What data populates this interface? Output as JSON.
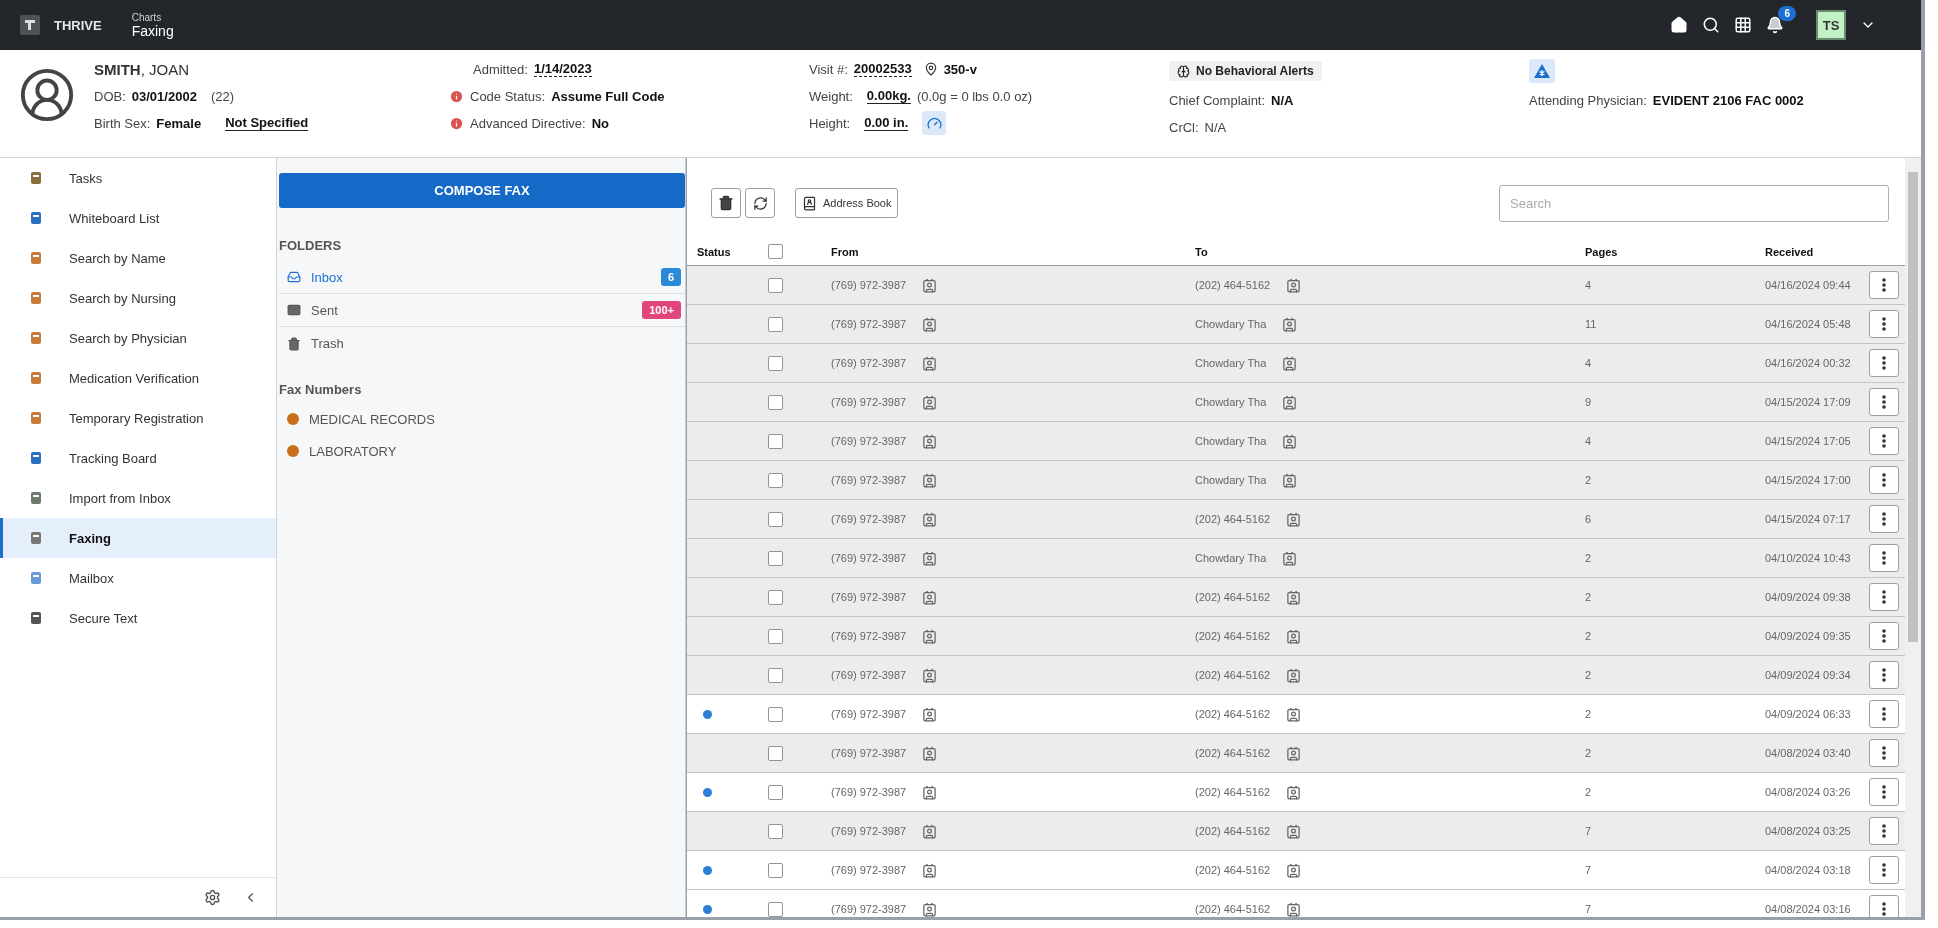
{
  "app": {
    "brand": "THRIVE",
    "breadcrumb": "Charts",
    "title": "Faxing",
    "notifications": "6",
    "user_initials": "TS"
  },
  "patient": {
    "name": "**SMITH**, JOAN",
    "dob_label": "DOB:",
    "dob": "03/01/2002",
    "age": "(22)",
    "sex_label": "Birth Sex:",
    "sex": "Female",
    "gender": "Not Specified",
    "admitted_label": "Admitted:",
    "admitted": "1/14/2023",
    "code_status_label": "Code Status:",
    "code_status": "Assume Full Code",
    "directive_label": "Advanced Directive:",
    "directive": "No",
    "visit_label": "Visit #:",
    "visit": "20002533",
    "room": "350-v",
    "weight_label": "Weight:",
    "weight": "0.00kg.",
    "weight_note": "(0.0g = 0 lbs 0.0 oz)",
    "height_label": "Height:",
    "height": "0.00 in.",
    "behavioral": "No Behavioral Alerts",
    "complaint_label": "Chief Complaint:",
    "complaint": "N/A",
    "crcl_label": "CrCl:",
    "crcl": "N/A",
    "physician_label": "Attending Physician:",
    "physician": "EVIDENT 2106 FAC 0002"
  },
  "sidebar": {
    "items": [
      {
        "label": "Tasks",
        "selected": false
      },
      {
        "label": "Whiteboard List",
        "selected": false
      },
      {
        "label": "Search by Name",
        "selected": false
      },
      {
        "label": "Search by Nursing",
        "selected": false
      },
      {
        "label": "Search by Physician",
        "selected": false
      },
      {
        "label": "Medication Verification",
        "selected": false
      },
      {
        "label": "Temporary Registration",
        "selected": false
      },
      {
        "label": "Tracking Board",
        "selected": false
      },
      {
        "label": "Import from Inbox",
        "selected": false
      },
      {
        "label": "Faxing",
        "selected": true
      },
      {
        "label": "Mailbox",
        "selected": false
      },
      {
        "label": "Secure Text",
        "selected": false
      }
    ]
  },
  "folders_panel": {
    "compose": "COMPOSE FAX",
    "folders_title": "FOLDERS",
    "folders": [
      {
        "label": "Inbox",
        "selected": true,
        "count": "6",
        "color": "#2b8ad8"
      },
      {
        "label": "Sent",
        "selected": false,
        "count": "100+",
        "color": "#e0457b"
      },
      {
        "label": "Trash",
        "selected": false
      }
    ],
    "fax_numbers_title": "Fax Numbers",
    "fax_numbers": [
      {
        "label": "MEDICAL RECORDS",
        "color": "#c8701e"
      },
      {
        "label": "LABORATORY",
        "color": "#c8701e"
      }
    ]
  },
  "toolbar": {
    "address_book": "Address Book",
    "search_placeholder": "Search"
  },
  "table": {
    "columns": [
      "Status",
      "From",
      "To",
      "Pages",
      "Received"
    ],
    "all_checked": false,
    "rows": [
      {
        "unread": false,
        "checked": false,
        "from": "(769) 972-3987",
        "to": "(202) 464-5162",
        "pages": "4",
        "received": "04/16/2024 09:44"
      },
      {
        "unread": false,
        "checked": false,
        "from": "(769) 972-3987",
        "to": "Chowdary Tha",
        "pages": "11",
        "received": "04/16/2024 05:48"
      },
      {
        "unread": false,
        "checked": false,
        "from": "(769) 972-3987",
        "to": "Chowdary Tha",
        "pages": "4",
        "received": "04/16/2024 00:32"
      },
      {
        "unread": false,
        "checked": false,
        "from": "(769) 972-3987",
        "to": "Chowdary Tha",
        "pages": "9",
        "received": "04/15/2024 17:09"
      },
      {
        "unread": false,
        "checked": false,
        "from": "(769) 972-3987",
        "to": "Chowdary Tha",
        "pages": "4",
        "received": "04/15/2024 17:05"
      },
      {
        "unread": false,
        "checked": false,
        "from": "(769) 972-3987",
        "to": "Chowdary Tha",
        "pages": "2",
        "received": "04/15/2024 17:00"
      },
      {
        "unread": false,
        "checked": false,
        "from": "(769) 972-3987",
        "to": "(202) 464-5162",
        "pages": "6",
        "received": "04/15/2024 07:17"
      },
      {
        "unread": false,
        "checked": false,
        "from": "(769) 972-3987",
        "to": "Chowdary Tha",
        "pages": "2",
        "received": "04/10/2024 10:43"
      },
      {
        "unread": false,
        "checked": false,
        "from": "(769) 972-3987",
        "to": "(202) 464-5162",
        "pages": "2",
        "received": "04/09/2024 09:38"
      },
      {
        "unread": false,
        "checked": false,
        "from": "(769) 972-3987",
        "to": "(202) 464-5162",
        "pages": "2",
        "received": "04/09/2024 09:35"
      },
      {
        "unread": false,
        "checked": false,
        "from": "(769) 972-3987",
        "to": "(202) 464-5162",
        "pages": "2",
        "received": "04/09/2024 09:34"
      },
      {
        "unread": true,
        "checked": false,
        "from": "(769) 972-3987",
        "to": "(202) 464-5162",
        "pages": "2",
        "received": "04/09/2024 06:33"
      },
      {
        "unread": false,
        "checked": false,
        "from": "(769) 972-3987",
        "to": "(202) 464-5162",
        "pages": "2",
        "received": "04/08/2024 03:40"
      },
      {
        "unread": true,
        "checked": false,
        "from": "(769) 972-3987",
        "to": "(202) 464-5162",
        "pages": "2",
        "received": "04/08/2024 03:26"
      },
      {
        "unread": false,
        "checked": false,
        "from": "(769) 972-3987",
        "to": "(202) 464-5162",
        "pages": "7",
        "received": "04/08/2024 03:25"
      },
      {
        "unread": true,
        "checked": false,
        "from": "(769) 972-3987",
        "to": "(202) 464-5162",
        "pages": "7",
        "received": "04/08/2024 03:18"
      },
      {
        "unread": true,
        "checked": false,
        "from": "(769) 972-3987",
        "to": "(202) 464-5162",
        "pages": "7",
        "received": "04/08/2024 03:16"
      }
    ]
  }
}
